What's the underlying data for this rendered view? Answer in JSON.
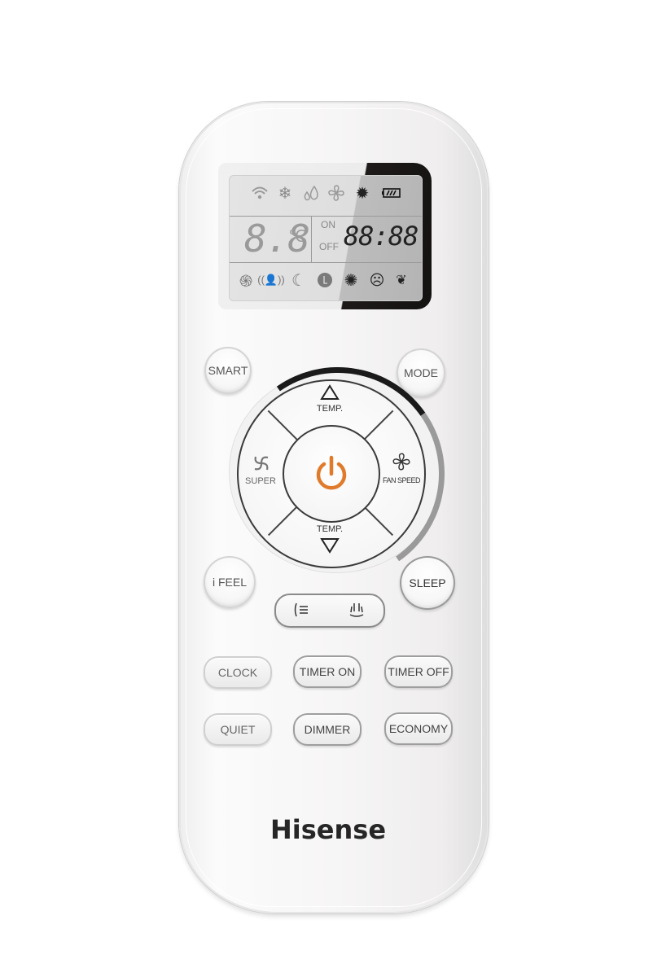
{
  "brand": "Hisense",
  "lcd": {
    "top_icons": [
      "signal-icon",
      "snowflake-icon",
      "humidity-drops-icon",
      "fan-icon",
      "sun-icon",
      "battery-icon"
    ],
    "temperature": "8.8",
    "temp_unit": "℃",
    "on_label": "ON",
    "off_label": "OFF",
    "time": "88:88",
    "bottom_icons": [
      "super-swirl-icon",
      "i-feel-person-icon",
      "sleep-moon-icon",
      "clock-l-icon",
      "dimmer-icon",
      "quiet-face-icon",
      "economy-icon"
    ]
  },
  "buttons": {
    "smart": "SMART",
    "mode": "MODE",
    "temp_up": "TEMP.",
    "temp_down": "TEMP.",
    "super": "SUPER",
    "fan_speed": "FAN SPEED",
    "i_feel": "i FEEL",
    "sleep": "SLEEP",
    "clock": "CLOCK",
    "timer_on": "TIMER ON",
    "timer_off": "TIMER OFF",
    "quiet": "QUIET",
    "dimmer": "DIMMER",
    "economy": "ECONOMY"
  },
  "colors": {
    "power_accent": "#e07b2c",
    "logo": "#262626",
    "lcd_bg": "#dedede"
  }
}
